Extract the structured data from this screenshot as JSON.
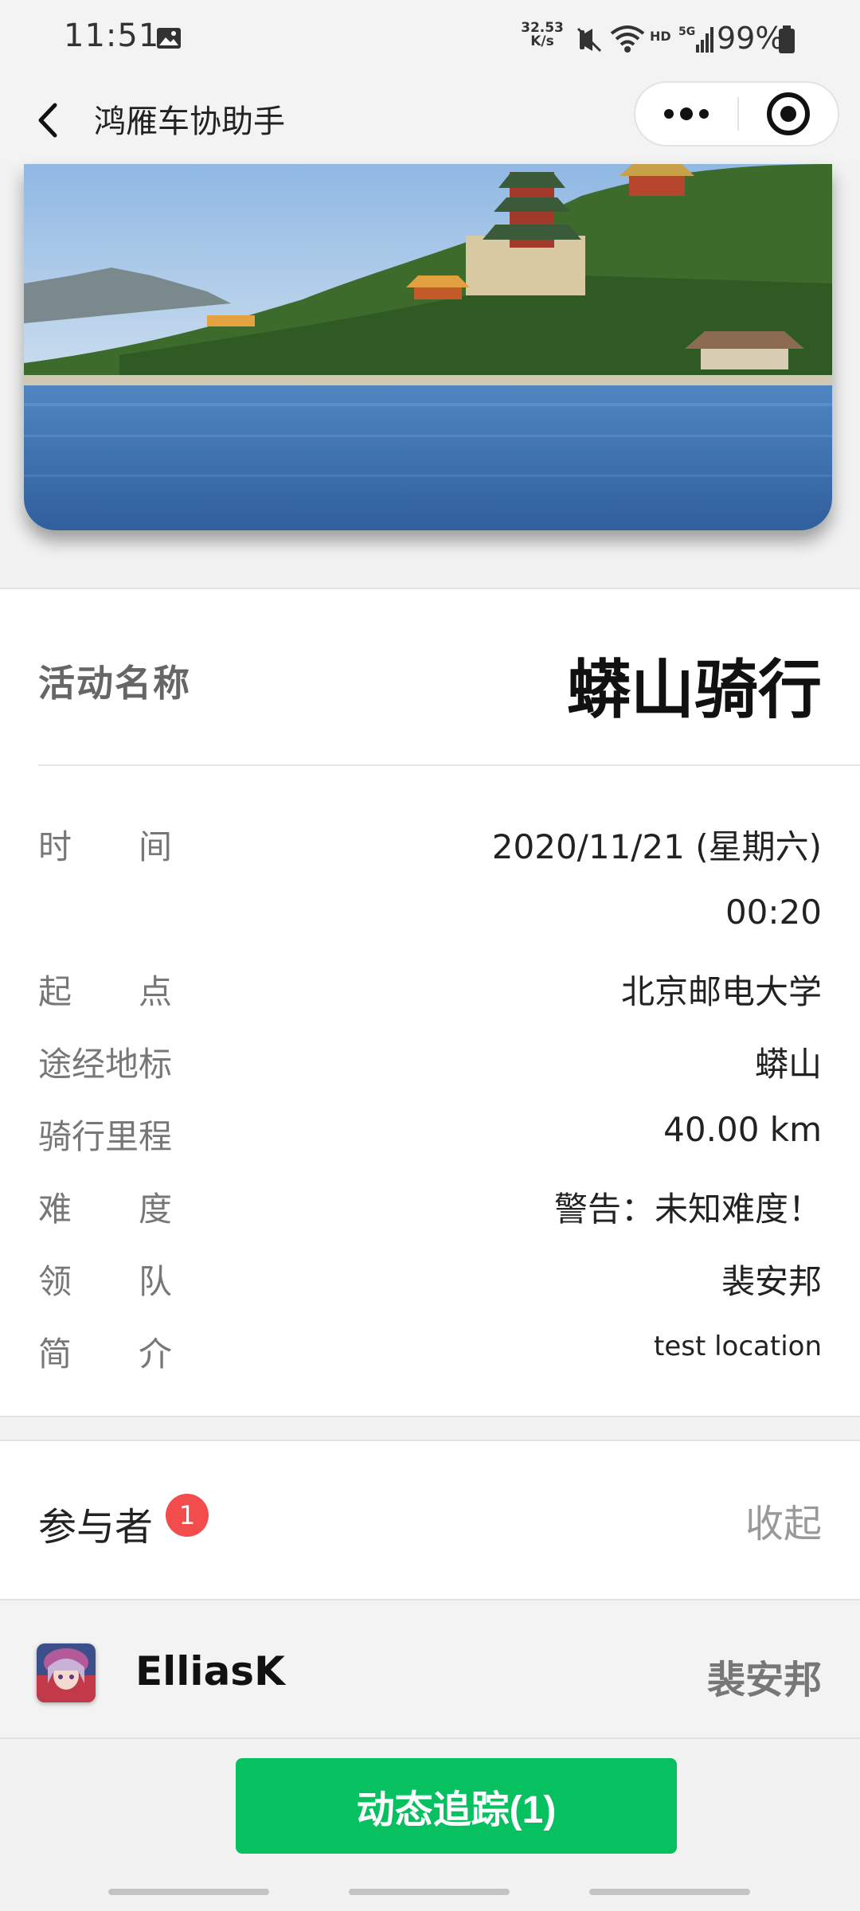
{
  "status_bar": {
    "time": "11:51",
    "net_speed_value": "32.53",
    "net_speed_unit": "K/s",
    "network_label": "HD",
    "signal_label": "5G",
    "battery": "99%"
  },
  "nav": {
    "title": "鸿雁车协助手"
  },
  "banner": {
    "colors": {
      "sky": "#9ec3e6",
      "water": "#3f72b0",
      "trees": "#3b6b2a"
    }
  },
  "activity": {
    "label": "活动名称",
    "name": "蟒山骑行"
  },
  "details": [
    {
      "label": "时　　间",
      "value": "2020/11/21 (星期六)"
    },
    {
      "label": "",
      "value": "00:20"
    },
    {
      "label": "起　　点",
      "value": "北京邮电大学"
    },
    {
      "label": "途经地标",
      "value": "蟒山"
    },
    {
      "label": "骑行里程",
      "value": "40.00 km"
    },
    {
      "label": "难　　度",
      "value": "警告：未知难度！"
    },
    {
      "label": "领　　队",
      "value": "裴安邦"
    },
    {
      "label": "简　　介",
      "value": "test location"
    }
  ],
  "participants": {
    "title": "参与者",
    "count": "1",
    "collapse_label": "收起",
    "items": [
      {
        "name": "ElliasK",
        "role": "裴安邦"
      }
    ]
  },
  "actions": {
    "track_label": "动态追踪(1)"
  },
  "theme": {
    "accent": "#07c160",
    "badge": "#f24c4c"
  }
}
